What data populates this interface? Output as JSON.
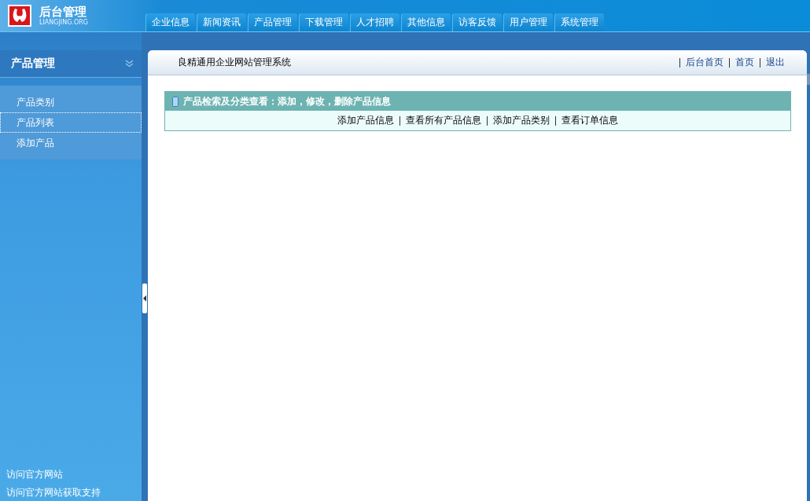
{
  "logo": {
    "title": "后台管理",
    "subtitle": "LIANGJING.ORG"
  },
  "tabs": [
    {
      "label": "企业信息"
    },
    {
      "label": "新闻资讯"
    },
    {
      "label": "产品管理"
    },
    {
      "label": "下载管理"
    },
    {
      "label": "人才招聘"
    },
    {
      "label": "其他信息"
    },
    {
      "label": "访客反馈"
    },
    {
      "label": "用户管理"
    },
    {
      "label": "系统管理"
    }
  ],
  "sidebar": {
    "title": "产品管理",
    "items": [
      {
        "label": "产品类别",
        "selected": false
      },
      {
        "label": "产品列表",
        "selected": true
      },
      {
        "label": "添加产品",
        "selected": false
      }
    ],
    "footer_links": [
      "访问官方网站",
      "访问官方网站获取支持"
    ]
  },
  "main": {
    "title": "良精通用企业网站管理系统",
    "top_links": [
      "后台首页",
      "首页",
      "退出"
    ],
    "panel": {
      "heading": "产品检索及分类查看：添加，修改，删除产品信息",
      "links": [
        "添加产品信息",
        "查看所有产品信息",
        "添加产品类别",
        "查看订单信息"
      ]
    }
  }
}
